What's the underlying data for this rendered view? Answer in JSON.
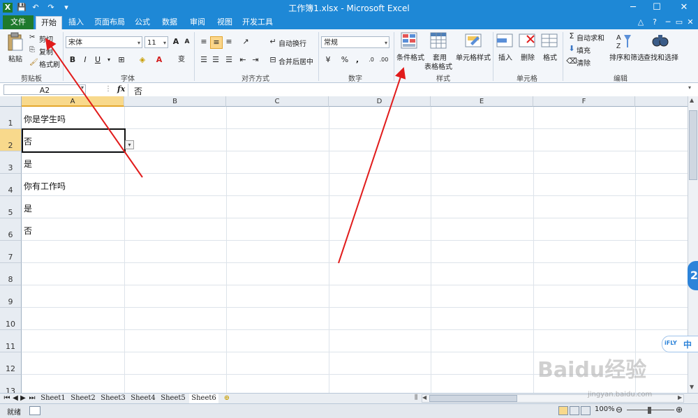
{
  "window": {
    "title": "工作簿1.xlsx - Microsoft Excel",
    "app_icon": "X",
    "controls": {
      "minimize": "─",
      "maximize": "☐",
      "close": "✕"
    }
  },
  "quick_access": {
    "save": "💾",
    "undo": "↶",
    "redo": "↷",
    "customize": "▾"
  },
  "tabs": [
    "文件",
    "开始",
    "插入",
    "页面布局",
    "公式",
    "数据",
    "审阅",
    "视图",
    "开发工具"
  ],
  "ribbon": {
    "clipboard": {
      "paste": "粘贴",
      "cut": "剪切",
      "copy": "复制",
      "format_painter": "格式刷",
      "label": "剪贴板"
    },
    "font": {
      "name": "宋体",
      "size": "11",
      "bold": "B",
      "italic": "I",
      "underline": "U",
      "grow": "A",
      "shrink": "A",
      "color_a": "A",
      "wen": "变",
      "label": "字体"
    },
    "alignment": {
      "wrap": "自动换行",
      "merge": "合并后居中",
      "label": "对齐方式"
    },
    "number": {
      "format": "常规",
      "percent": "%",
      "comma": ",",
      "inc": ".0",
      "dec": ".00",
      "label": "数字"
    },
    "styles": {
      "conditional": "条件格式",
      "table": "套用",
      "table2": "表格格式",
      "cell": "单元格样式",
      "label": "样式"
    },
    "cells": {
      "insert": "插入",
      "delete": "删除",
      "format": "格式",
      "label": "单元格"
    },
    "editing": {
      "autosum": "自动求和",
      "fill": "填充",
      "clear": "清除",
      "sort": "排序和筛选",
      "find": "查找和选择",
      "label": "编辑"
    }
  },
  "formula_bar": {
    "name_box": "A2",
    "fx": "fx",
    "value": "否"
  },
  "columns": [
    "A",
    "B",
    "C",
    "D",
    "E",
    "F"
  ],
  "rows": [
    "1",
    "2",
    "3",
    "4",
    "5",
    "6",
    "7",
    "8",
    "9",
    "10",
    "11",
    "12",
    "13"
  ],
  "cells": {
    "A1": "你是学生吗",
    "A2": "否",
    "A3": "是",
    "A4": "你有工作吗",
    "A5": "是",
    "A6": "否"
  },
  "sheets": [
    "Sheet1",
    "Sheet2",
    "Sheet3",
    "Sheet4",
    "Sheet5",
    "Sheet6"
  ],
  "status": {
    "ready": "就绪",
    "zoom": "100%"
  },
  "ime": {
    "brand": "iFLY",
    "mode": "中"
  },
  "watermark": {
    "text": "Baidu经验",
    "url": "jingyan.baidu.com"
  },
  "colors": {
    "title_blue": "#1e88d6",
    "file_green": "#1f7a2c",
    "arrow_red": "#e11b1b",
    "selected_header": "#f8d98c"
  }
}
